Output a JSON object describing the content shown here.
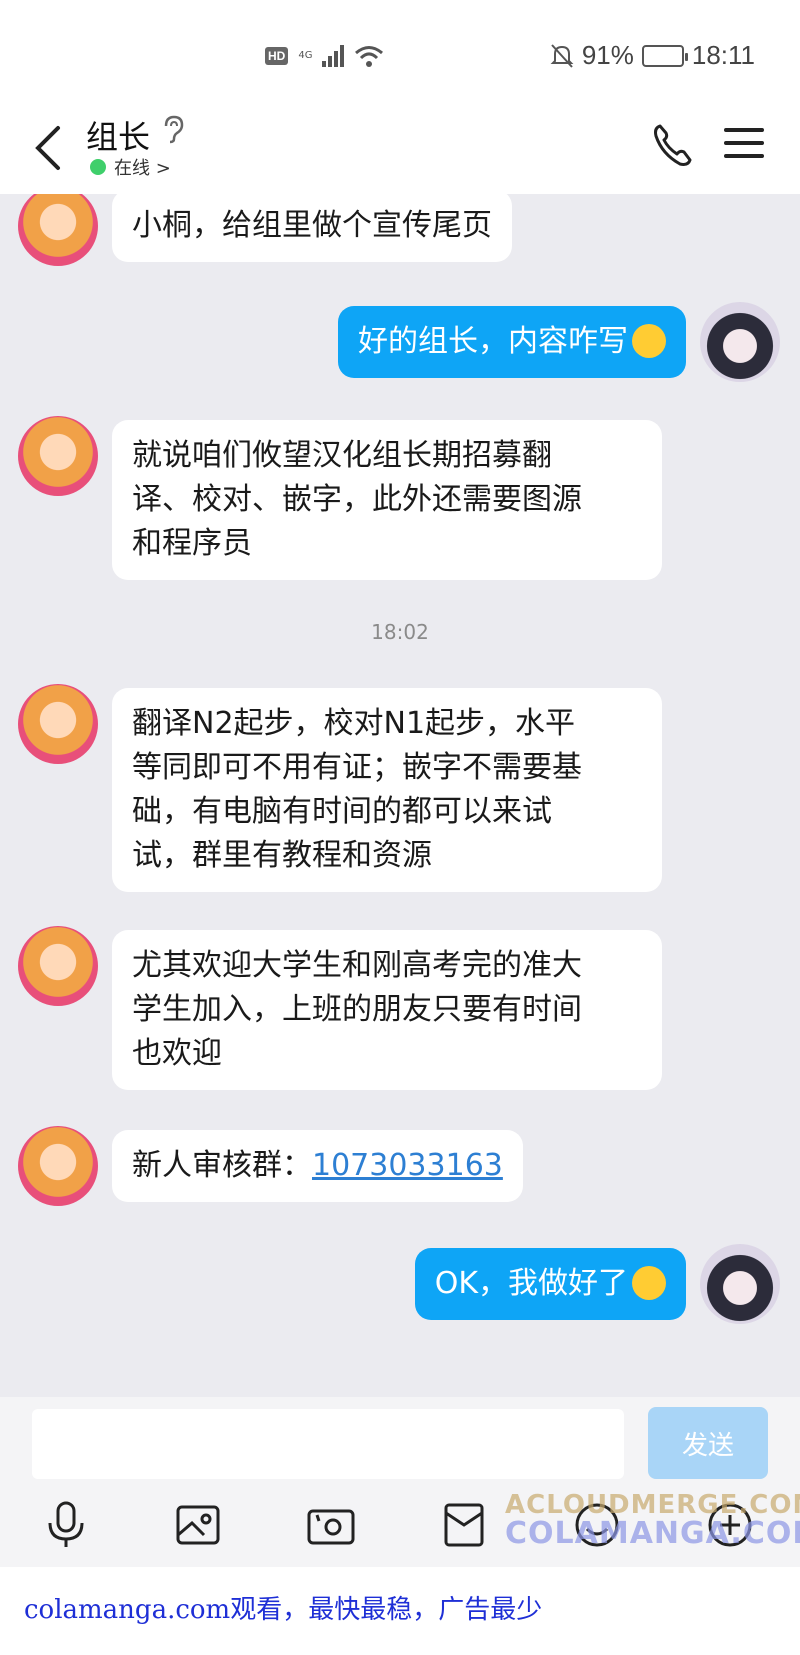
{
  "status_bar": {
    "hd_label": "HD",
    "network_label": "4G",
    "battery_text": "91%",
    "battery_level": 0.91,
    "time": "18:11"
  },
  "header": {
    "title": "组长",
    "online_status": "在线 >"
  },
  "messages": [
    {
      "from": "other",
      "text": "小桐，给组里做个宣传尾页"
    },
    {
      "from": "me",
      "text": "好的组长，内容咋写"
    },
    {
      "from": "other",
      "lines": [
        "就说咱们攸望汉化组长期招募翻",
        "译、校对、嵌字，此外还需要图源",
        "和程序员"
      ]
    },
    {
      "type": "timestamp",
      "text": "18:02"
    },
    {
      "from": "other",
      "lines": [
        "翻译N2起步，校对N1起步，水平",
        "等同即可不用有证；嵌字不需要基",
        "础，有电脑有时间的都可以来试",
        "试，群里有教程和资源"
      ]
    },
    {
      "from": "other",
      "lines": [
        "尤其欢迎大学生和刚高考完的准大",
        "学生加入，上班的朋友只要有时间",
        "也欢迎"
      ]
    },
    {
      "from": "other",
      "prefix": "新人审核群：",
      "link": "1073033163"
    },
    {
      "from": "me",
      "text": "OK，我做好了"
    }
  ],
  "input": {
    "placeholder": "",
    "send_label": "发送"
  },
  "toolbar_icons": [
    "microphone-icon",
    "image-icon",
    "camera-icon",
    "red-packet-icon",
    "emoji-icon",
    "plus-icon"
  ],
  "watermark": {
    "line1": "ACLOUDMERGE.COM",
    "line2": "COLAMANGA.COM"
  },
  "footer_text": "colamanga.com观看，最快最稳，广告最少"
}
